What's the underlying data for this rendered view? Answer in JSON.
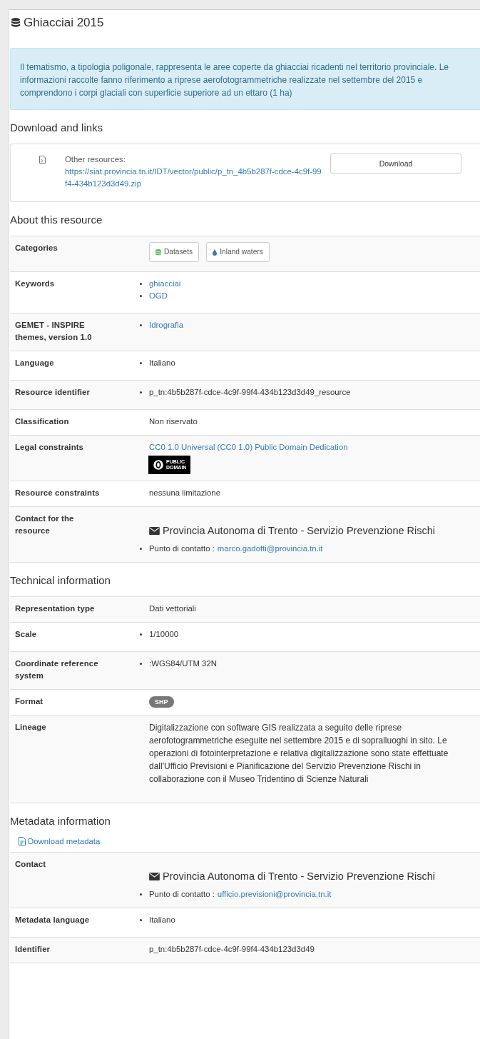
{
  "title": "Ghiacciai 2015",
  "description": "Il tematismo, a tipologia poligonale, rappresenta le aree coperte da ghiacciai ricadenti nel territorio provinciale. Le informazioni raccolte fanno riferimento a riprese aerofotogrammetriche realizzate nel settembre del 2015 e comprendono i corpi glaciali con superficie superiore ad un ettaro (1 ha)",
  "download": {
    "heading": "Download and links",
    "resources": [
      {
        "label": "Other resources:",
        "url": "https://siat.provincia.tn.it/IDT/vector/public/p_tn_4b5b287f-cdce-4c9f-99f4-434b123d3d49.zip",
        "button": "Download"
      }
    ]
  },
  "about": {
    "heading": "About this resource",
    "rows": [
      {
        "label": "Categories",
        "kind": "chips",
        "items": [
          {
            "label": "Datasets",
            "kind": "stack"
          },
          {
            "label": "Inland waters",
            "kind": "drop"
          }
        ]
      },
      {
        "label": "Keywords",
        "kind": "links",
        "items": [
          "ghiacciai",
          "OGD"
        ]
      },
      {
        "label": "GEMET - INSPIRE themes, version 1.0",
        "kind": "links",
        "items": [
          "Idrografia"
        ]
      },
      {
        "label": "Language",
        "kind": "bullets",
        "items": [
          "Italiano"
        ]
      },
      {
        "label": "Resource identifier",
        "kind": "bullets",
        "items": [
          "p_tn:4b5b287f-cdce-4c9f-99f4-434b123d3d49_resource"
        ]
      },
      {
        "label": "Classification",
        "kind": "text",
        "value": "Non riservato"
      },
      {
        "label": "Legal constraints",
        "kind": "license",
        "link": "CC0 1.0 Universal (CC0 1.0) Public Domain Dedication",
        "badge": [
          "PUBLIC",
          "DOMAIN"
        ]
      },
      {
        "label": "Resource constraints",
        "kind": "text",
        "value": "nessuna limitazione"
      },
      {
        "label": "Contact for the resource",
        "kind": "contact",
        "org": "Provincia Autonoma di Trento - Servizio Prevenzione Rischi",
        "contact_label": "Punto di contatto :",
        "email": "marco.gadotti@provincia.tn.it"
      }
    ]
  },
  "technical": {
    "heading": "Technical information",
    "rows": [
      {
        "label": "Representation type",
        "kind": "text",
        "value": "Dati vettoriali"
      },
      {
        "label": "Scale",
        "kind": "bullets",
        "items": [
          "1/10000"
        ]
      },
      {
        "label": "Coordinate reference system",
        "kind": "bullets",
        "items": [
          ":WGS84/UTM 32N"
        ]
      },
      {
        "label": "Format",
        "kind": "badge",
        "value": "SHP"
      },
      {
        "label": "Lineage",
        "kind": "paragraph",
        "value": "Digitalizzazione con software GIS realizzata a seguito delle riprese aerofotogrammetriche eseguite nel settembre 2015 e di sopralluoghi in sito. Le operazioni di fotointerpretazione e relativa digitalizzazione sono state effettuate dall'Ufficio Previsioni e Pianificazione del Servizio Prevenzione Rischi in collaborazione con il Museo Tridentino di Scienze Naturali"
      }
    ]
  },
  "metadata": {
    "heading": "Metadata information",
    "download_link": "Download metadata",
    "rows": [
      {
        "label": "Contact",
        "kind": "contact",
        "org": "Provincia Autonoma di Trento - Servizio Prevenzione Rischi",
        "contact_label": "Punto di contatto :",
        "email": "ufficio.previsioni@provincia.tn.it"
      },
      {
        "label": "Metadata language",
        "kind": "bullets",
        "items": [
          "Italiano"
        ]
      },
      {
        "label": "Identifier",
        "kind": "text",
        "value": "p_tn:4b5b287f-cdce-4c9f-99f4-434b123d3d49"
      }
    ]
  }
}
